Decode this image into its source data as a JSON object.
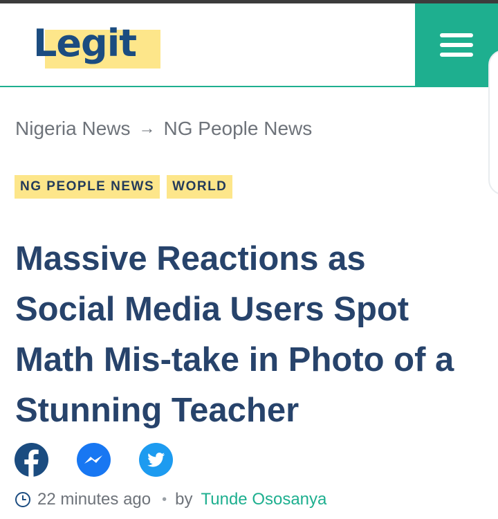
{
  "header": {
    "logo_text": "Legit",
    "menu_icon": "hamburger-menu-icon",
    "accent_color": "#1eaf8f",
    "logo_color": "#1b4c80",
    "logo_highlight": "#fde68a"
  },
  "breadcrumb": {
    "items": [
      "Nigeria News",
      "NG People News"
    ],
    "separator": "→"
  },
  "tags": [
    "NG PEOPLE NEWS",
    "WORLD"
  ],
  "article": {
    "title": "Massive Reactions as Social Media Users Spot Math Mis-take in Photo of a Stunning Teacher"
  },
  "share": {
    "icons": [
      "facebook-icon",
      "messenger-icon",
      "twitter-icon"
    ]
  },
  "meta": {
    "time": "22 minutes ago",
    "separator": "•",
    "by_label": "by",
    "author": "Tunde Ososanya"
  }
}
